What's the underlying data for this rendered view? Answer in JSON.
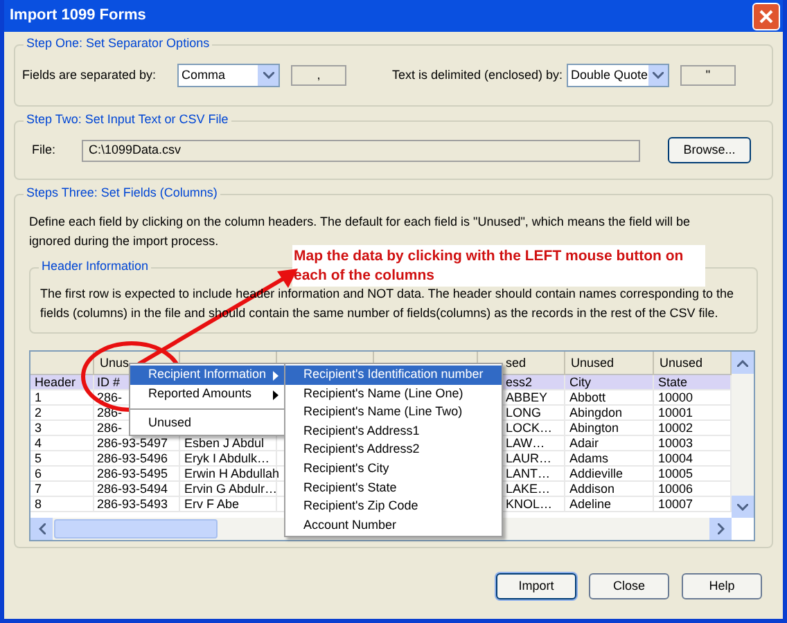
{
  "window": {
    "title": "Import 1099 Forms"
  },
  "step_one": {
    "title": "Step One: Set Separator Options",
    "fields_label": "Fields are separated by:",
    "separator": {
      "value": "Comma",
      "symbol": ","
    },
    "delimiter_label": "Text is delimited (enclosed) by:",
    "delimiter": {
      "value": "Double Quote",
      "symbol": "\""
    }
  },
  "step_two": {
    "title": "Step Two: Set Input Text or CSV File",
    "file_label": "File:",
    "file_value": "C:\\1099Data.csv",
    "browse": "Browse..."
  },
  "step_three": {
    "title": "Steps Three: Set Fields (Columns)",
    "description": "Define each field by clicking on the column headers. The default for each field is \"Unused\", which means the field will be ignored during the import process.",
    "header_info": {
      "title": "Header Information",
      "text": "The first row is expected to include header information and NOT data. The header should contain names corresponding to the fields (columns) in the file and should contain the same number of fields(columns) as the records in the rest of the CSV file."
    }
  },
  "grid": {
    "columns": [
      "",
      "Unus",
      "",
      "",
      "",
      "sed",
      "Unused",
      "Unused"
    ],
    "rows": [
      {
        "selected": true,
        "cells": [
          "Header",
          "ID #",
          "",
          "",
          "",
          "ess2",
          "City",
          "State"
        ]
      },
      {
        "selected": false,
        "cells": [
          "1",
          "286-",
          "",
          "",
          "",
          "ABBEY",
          "Abbott",
          "10000"
        ]
      },
      {
        "selected": false,
        "cells": [
          "2",
          "286-",
          "",
          "",
          "",
          "LONG",
          "Abingdon",
          "10001"
        ]
      },
      {
        "selected": false,
        "cells": [
          "3",
          "286-",
          "",
          "",
          "",
          "LOCK…",
          "Abington",
          "10002"
        ]
      },
      {
        "selected": false,
        "cells": [
          "4",
          "286-93-5497",
          "Esben J  Abdul",
          "",
          "",
          "LAW…",
          "Adair",
          "10003"
        ]
      },
      {
        "selected": false,
        "cells": [
          "5",
          "286-93-5496",
          "Eryk  I  Abdulk…",
          "",
          "",
          "LAUR…",
          "Adams",
          "10004"
        ]
      },
      {
        "selected": false,
        "cells": [
          "6",
          "286-93-5495",
          "Erwin H  Abdullah",
          "",
          "",
          "LANT…",
          "Addieville",
          "10005"
        ]
      },
      {
        "selected": false,
        "cells": [
          "7",
          "286-93-5494",
          "Ervin G  Abdulr…",
          "",
          "",
          "LAKE…",
          "Addison",
          "10006"
        ]
      },
      {
        "selected": false,
        "cells": [
          "8",
          "286-93-5493",
          "Erv   F  Abe",
          "",
          "",
          "KNOL…",
          "Adeline",
          "10007"
        ]
      }
    ]
  },
  "context_menu": {
    "items": [
      {
        "kind": "item",
        "label": "Recipient Information",
        "submenu": true,
        "selected": true
      },
      {
        "kind": "item",
        "label": "Reported Amounts",
        "submenu": true,
        "selected": false
      },
      {
        "kind": "separator"
      },
      {
        "kind": "item",
        "label": "Unused",
        "submenu": false,
        "selected": false
      }
    ]
  },
  "submenu": {
    "items": [
      {
        "label": "Recipient's Identification number",
        "selected": true
      },
      {
        "label": "Recipient's Name (Line One)",
        "selected": false
      },
      {
        "label": "Recipient's Name (Line Two)",
        "selected": false
      },
      {
        "label": "Recipient's Address1",
        "selected": false
      },
      {
        "label": "Recipient's Address2",
        "selected": false
      },
      {
        "label": "Recipient's City",
        "selected": false
      },
      {
        "label": "Recipient's State",
        "selected": false
      },
      {
        "label": "Recipient's Zip Code",
        "selected": false
      },
      {
        "label": "Account Number",
        "selected": false
      }
    ]
  },
  "annotation": {
    "text": "Map the data by clicking with the LEFT mouse button on each of the columns"
  },
  "buttons": [
    {
      "label": "Import",
      "default": true
    },
    {
      "label": "Close",
      "default": false
    },
    {
      "label": "Help",
      "default": false
    }
  ]
}
